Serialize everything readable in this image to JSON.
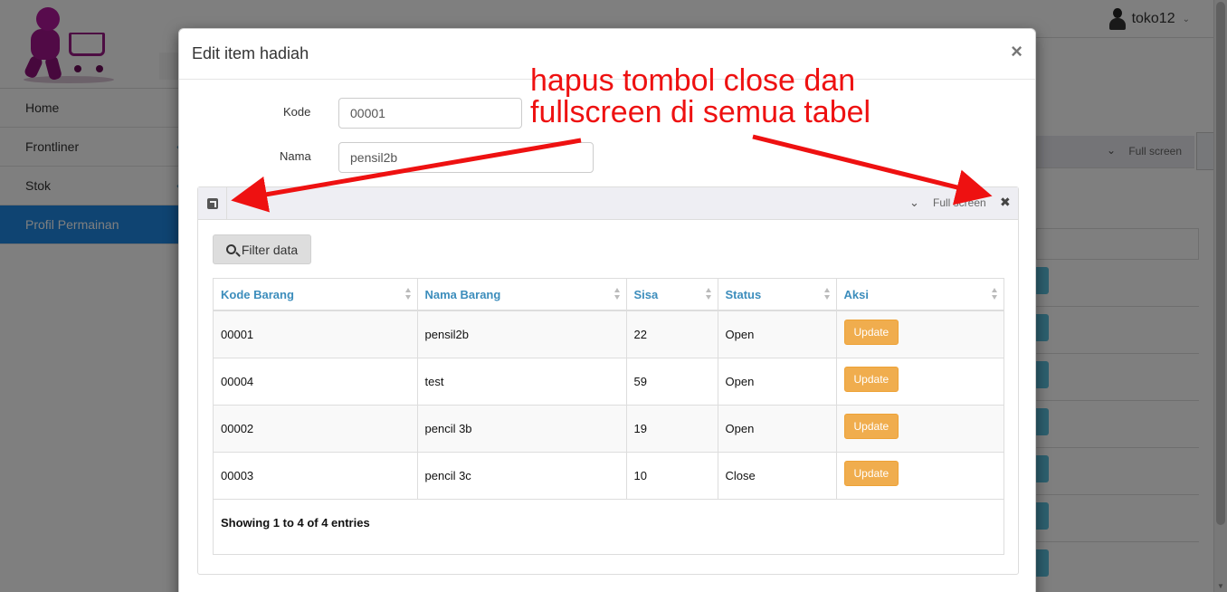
{
  "user": {
    "name": "toko12"
  },
  "sidebar": {
    "items": [
      {
        "label": "Home"
      },
      {
        "label": "Frontliner"
      },
      {
        "label": "Stok"
      },
      {
        "label": "Profil Permainan"
      }
    ]
  },
  "background": {
    "fullscreen_label": "Full screen"
  },
  "modal": {
    "title": "Edit item hadiah",
    "close_glyph": "×",
    "form": {
      "kode_label": "Kode",
      "kode_value": "00001",
      "nama_label": "Nama",
      "nama_value": "pensil2b"
    },
    "panel": {
      "fullscreen_label": "Full screen",
      "close_glyph": "✖",
      "filter_label": "Filter data",
      "table": {
        "columns": [
          "Kode Barang",
          "Nama Barang",
          "Sisa",
          "Status",
          "Aksi"
        ],
        "rows": [
          {
            "kode": "00001",
            "nama": "pensil2b",
            "sisa": "22",
            "status": "Open",
            "aksi": "Update"
          },
          {
            "kode": "00004",
            "nama": "test",
            "sisa": "59",
            "status": "Open",
            "aksi": "Update"
          },
          {
            "kode": "00002",
            "nama": "pencil 3b",
            "sisa": "19",
            "status": "Open",
            "aksi": "Update"
          },
          {
            "kode": "00003",
            "nama": "pencil 3c",
            "sisa": "10",
            "status": "Close",
            "aksi": "Update"
          }
        ],
        "info": "Showing 1 to 4 of 4 entries"
      }
    }
  },
  "annotation": {
    "line1": "hapus tombol close dan",
    "line2": "fullscreen di semua tabel",
    "color": "#ee1111"
  }
}
